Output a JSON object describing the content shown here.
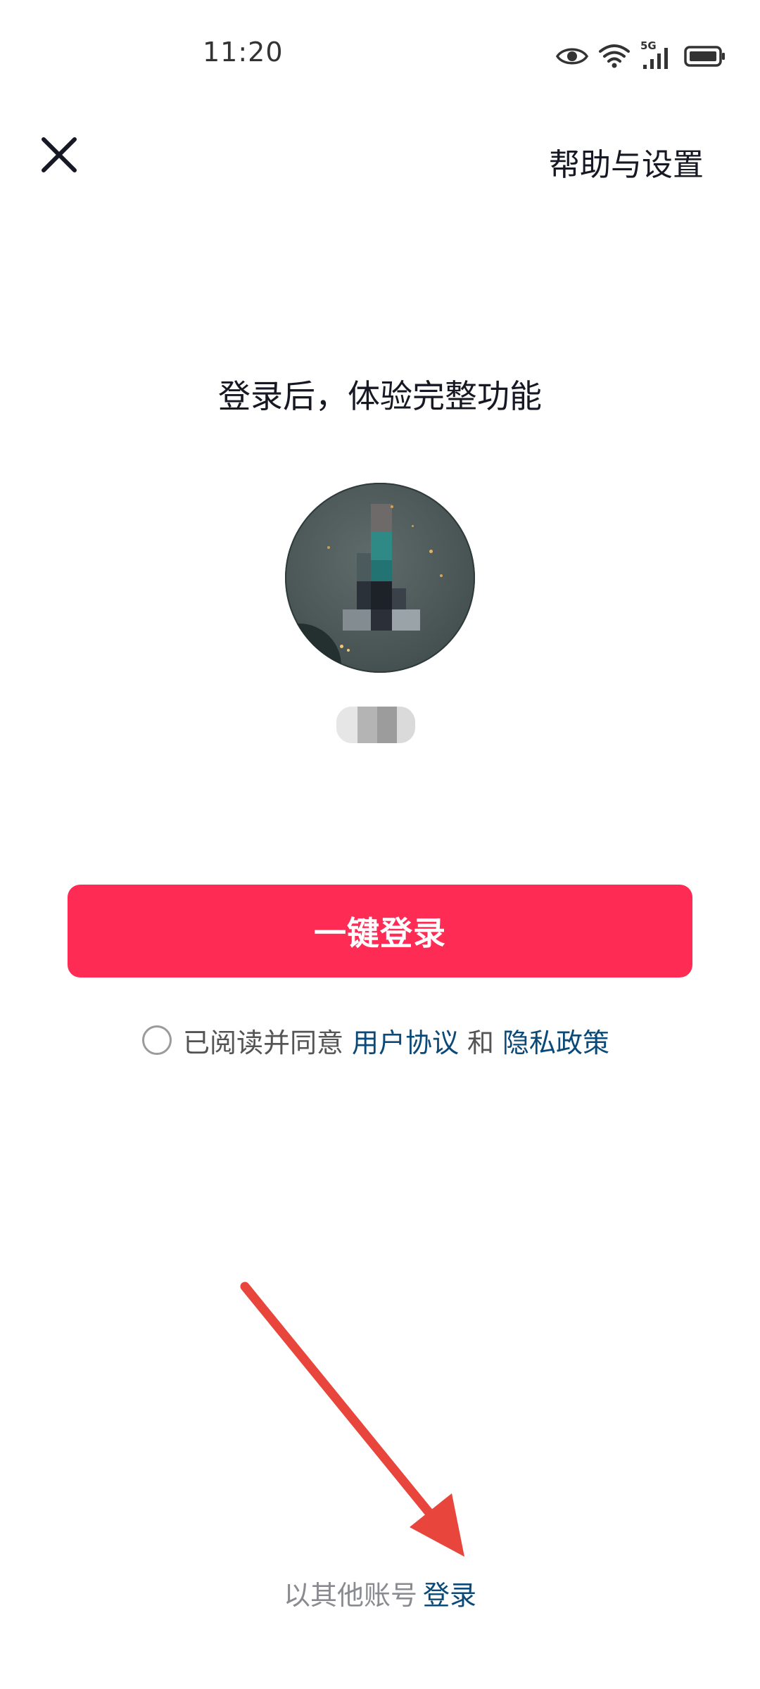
{
  "status_bar": {
    "time": "11:20",
    "network": "5G",
    "icons": [
      "eye-icon",
      "wifi-icon",
      "signal-icon",
      "battery-icon"
    ]
  },
  "header": {
    "close_icon": "close-icon",
    "help_settings": "帮助与设置"
  },
  "main": {
    "headline": "登录后，体验完整功能",
    "login_button": "一键登录"
  },
  "agreement": {
    "prefix": "已阅读并同意",
    "user_agreement": "用户协议",
    "and": "和",
    "privacy_policy": "隐私政策"
  },
  "footer": {
    "other_account_prefix": "以其他账号",
    "login_link": "登录"
  },
  "colors": {
    "primary": "#fe2c55",
    "link": "#0b4a78",
    "annotation_arrow": "#e8453c"
  }
}
